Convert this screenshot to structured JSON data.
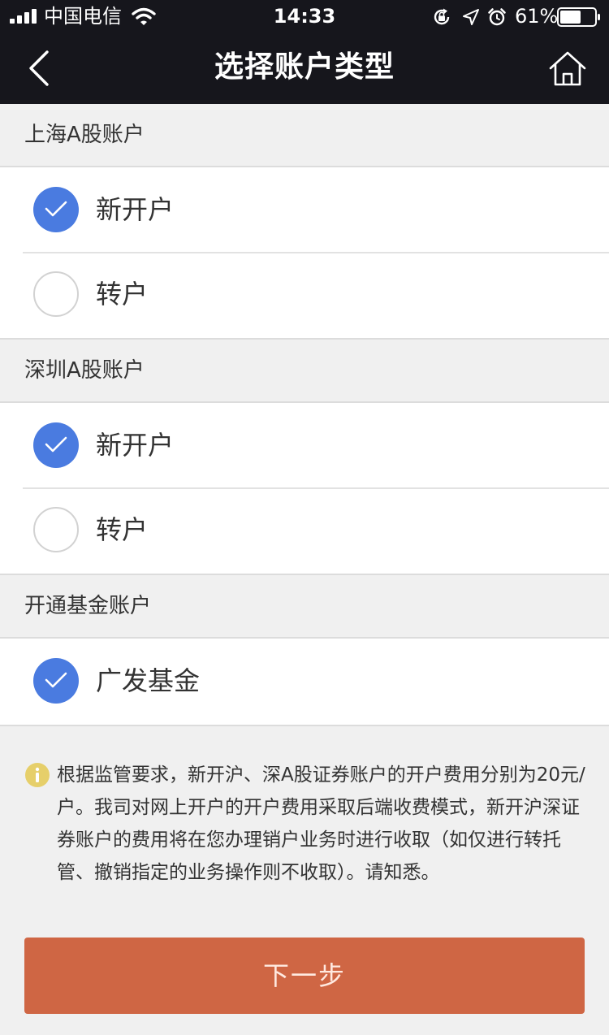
{
  "status_bar": {
    "carrier": "中国电信",
    "time": "14:33",
    "battery_percent": "61%",
    "battery_level": 0.61,
    "icons": [
      "signal-icon",
      "wifi-icon",
      "rotation-lock-icon",
      "location-arrow-icon",
      "alarm-icon",
      "battery-icon"
    ]
  },
  "nav": {
    "title": "选择账户类型",
    "back_icon": "chevron-left-icon",
    "home_icon": "home-icon"
  },
  "sections": [
    {
      "title": "上海A股账户",
      "options": [
        {
          "label": "新开户",
          "checked": true
        },
        {
          "label": "转户",
          "checked": false
        }
      ]
    },
    {
      "title": "深圳A股账户",
      "options": [
        {
          "label": "新开户",
          "checked": true
        },
        {
          "label": "转户",
          "checked": false
        }
      ]
    },
    {
      "title": "开通基金账户",
      "options": [
        {
          "label": "广发基金",
          "checked": true
        }
      ]
    }
  ],
  "notice": {
    "icon": "info-icon",
    "text": "根据监管要求，新开沪、深A股证券账户的开户费用分别为20元/户。我司对网上开户的开户费用采取后端收费模式，新开沪深证券账户的费用将在您办理销户业务时进行收取（如仅进行转托管、撤销指定的业务操作则不收取）。请知悉。"
  },
  "next_button": {
    "label": "下一步"
  },
  "colors": {
    "nav_background": "#16161c",
    "accent_blue": "#4a7be0",
    "button_orange": "#cf6644",
    "info_yellow": "#e6cf6a",
    "page_background": "#f0f0f0"
  }
}
